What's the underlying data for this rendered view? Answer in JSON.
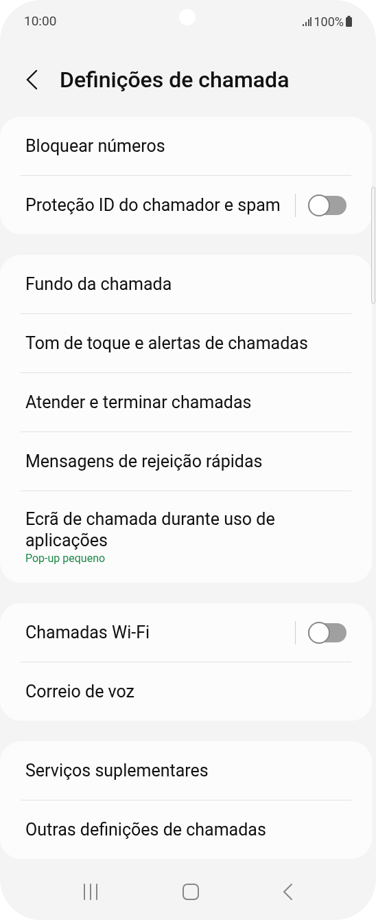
{
  "status_bar": {
    "time": "10:00",
    "battery": "100%"
  },
  "header": {
    "title": "Definições de chamada"
  },
  "sections": [
    {
      "items": [
        {
          "kind": "link",
          "label": "Bloquear números"
        },
        {
          "kind": "toggle",
          "label": "Proteção ID do chamador e spam",
          "on": false
        }
      ]
    },
    {
      "items": [
        {
          "kind": "link",
          "label": "Fundo da chamada"
        },
        {
          "kind": "link",
          "label": "Tom de toque e alertas de chamadas"
        },
        {
          "kind": "link",
          "label": "Atender e terminar chamadas"
        },
        {
          "kind": "link",
          "label": "Mensagens de rejeição rápidas"
        },
        {
          "kind": "link",
          "label": "Ecrã de chamada durante uso de aplicações",
          "subtitle": "Pop-up pequeno"
        }
      ]
    },
    {
      "items": [
        {
          "kind": "toggle",
          "label": "Chamadas Wi-Fi",
          "on": false
        },
        {
          "kind": "link",
          "label": "Correio de voz"
        }
      ]
    },
    {
      "items": [
        {
          "kind": "link",
          "label": "Serviços suplementares"
        },
        {
          "kind": "link",
          "label": "Outras definições de chamadas"
        }
      ]
    }
  ]
}
